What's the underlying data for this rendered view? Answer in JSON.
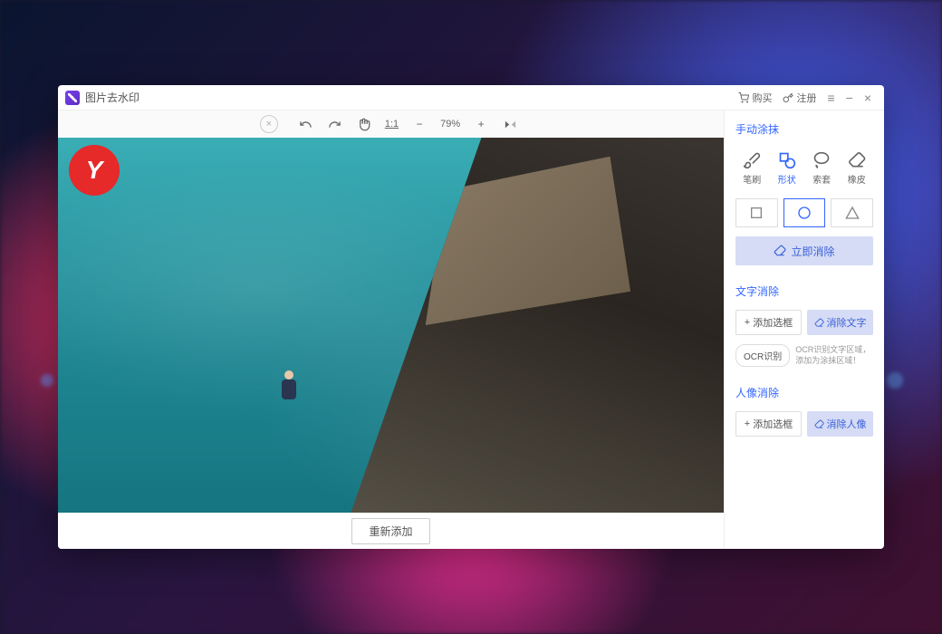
{
  "titlebar": {
    "app_title": "图片去水印",
    "buy": "购买",
    "register": "注册"
  },
  "toolbar": {
    "zoom": "79%",
    "ratio": "1:1"
  },
  "canvas": {
    "logo_letter": "Y"
  },
  "bottom": {
    "reupload": "重新添加"
  },
  "side": {
    "manual": {
      "title": "手动涂抹",
      "tools": {
        "brush": "笔刷",
        "shape": "形状",
        "lasso": "索套",
        "eraser": "橡皮"
      },
      "erase_now": "立即消除"
    },
    "text": {
      "title": "文字消除",
      "add_box": "添加选框",
      "erase_text": "消除文字",
      "ocr_btn": "OCR识别",
      "ocr_hint": "OCR识别文字区域，添加为涂抹区域！"
    },
    "person": {
      "title": "人像消除",
      "add_box": "添加选框",
      "erase_person": "消除人像"
    }
  }
}
